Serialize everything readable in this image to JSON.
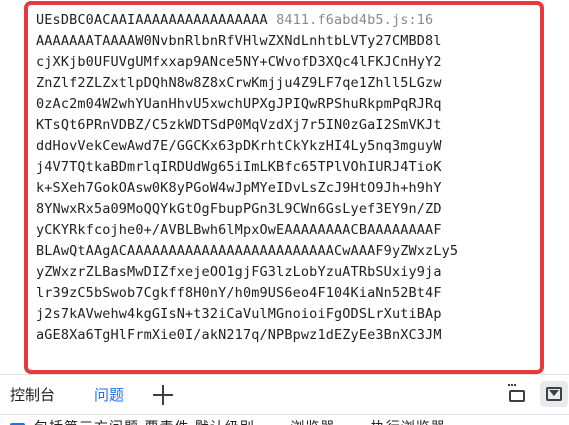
{
  "console": {
    "first_line_text": "UEsDBC0ACAAIAAAAAAAAAAAAAAAA ",
    "source_link": "8411.f6abd4b5.js:16",
    "lines": [
      "AAAAAAATAAAAW0NvbnRlbnRfVHlwZXNdLnhtbLVTy27CMBD8l",
      "cjXKjb0UFUVgUMfxxap9ANce5NY+CWvofD3XQc4lFKJCnHyY2",
      "ZnZlf2ZLZxtlpDQhN8w8Z8xCrwKmjju4Z9LF7qe1Zhll5LGzw",
      "0zAc2m04W2whYUanHhvU5xwchUPXgJPIQwRPShuRkpmPqRJRq",
      "KTsQt6PRnVDBZ/C5zkWDTSdP0MqVzdXj7r5IN0zGaI2SmVKJt",
      "ddHovVekCewAwd7E/GGCKx63pDKrhtCkYkzHI4Ly5nq3mguyW",
      "j4V7TQtkaBDmrlqIRDUdWg65iImLKBfc65TPlVOhIURJ4TioK",
      "k+SXeh7GokOAsw0K8yPGoW4wJpMYeIDvLsZcJ9HtO9Jh+h9hY",
      "8YNwxRx5a09MoQQYkGtOgFbupPGn3L9CWn6GsLyef3EY9n/ZD",
      "yCKYRkfcojhe0+/AVBLBwh6lMpxOwEAAAAAAAACBAAAAAAAAF",
      "BLAwQtAAgACAAAAAAAAAAAAAAAAAAAAAAAAACwAAAF9yZWxzLy5",
      "yZWxzrZLBasMwDIZfxejeOO1gjFG3lzLobYzuATRbSUxiy9ja",
      "lr39zC5bSwob7Cgkff8H0nY/h0m9US6eo4F104KiaNn52Bt4F",
      "j2s7kAVwehw4kgGIsN+t32iCaVulMGnoioiFgODSLrXutiBAp",
      "aGE8Xa6TgHlFrmXie0I/akN217q/NPBpwz1dEZyEe3BnXC3JM"
    ]
  },
  "drawer": {
    "tabs": [
      {
        "label": "控制台"
      },
      {
        "label": "问题"
      }
    ],
    "add_tab_icon": "plus-icon",
    "dock_icon": "dock-side-icon",
    "close_icon": "close-drawer-icon"
  },
  "filter": {
    "label": "包括第三方问题  要素件  默认级别  ……浏览器  ……执行浏览器"
  },
  "colors": {
    "highlight_border": "#e5393d",
    "active_tab": "#1a73e8",
    "source_link": "#8a8a8a"
  }
}
